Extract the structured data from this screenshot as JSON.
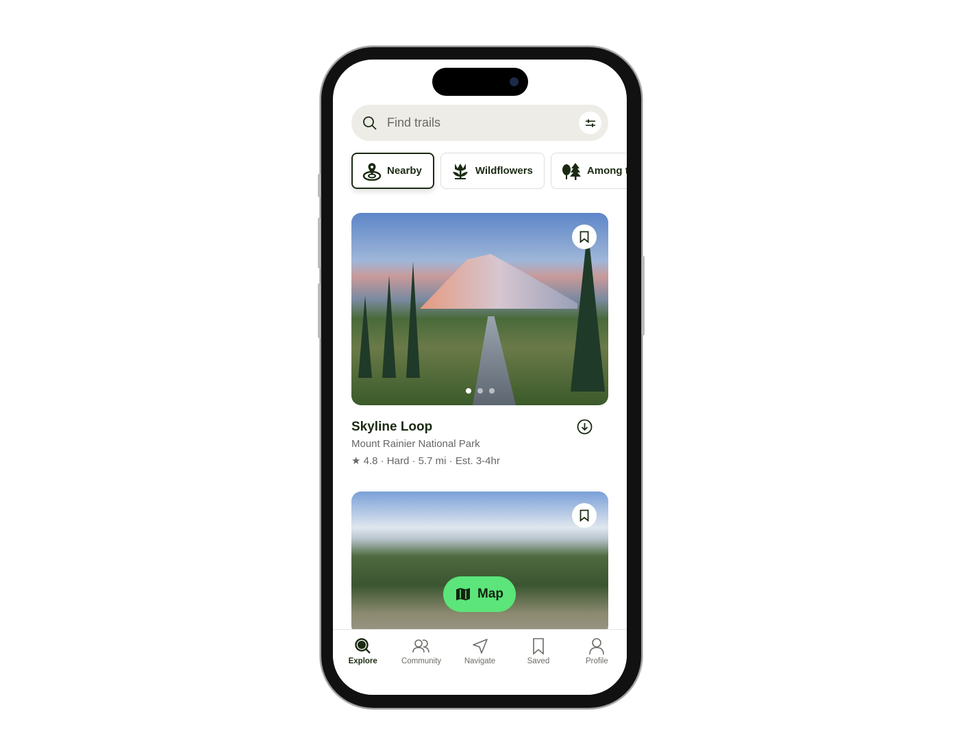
{
  "search": {
    "placeholder": "Find trails",
    "icon": "search-icon",
    "filter_icon": "sliders-icon"
  },
  "chips": [
    {
      "label": "Nearby",
      "icon": "location-pin-icon",
      "active": true
    },
    {
      "label": "Wildflowers",
      "icon": "flower-icon"
    },
    {
      "label": "Among the trees",
      "visible_label": "Among t",
      "icon": "trees-icon"
    }
  ],
  "trails": [
    {
      "name": "Skyline Loop",
      "park": "Mount Rainier National Park",
      "rating": "4.8",
      "difficulty": "Hard",
      "distance": "5.7 mi",
      "time": "Est. 3-4hr",
      "meta": "4.8 · Hard · 5.7 mi · Est. 3-4hr",
      "photos": 3,
      "current_photo": 1
    }
  ],
  "map_button": "Map",
  "nav": [
    {
      "label": "Explore",
      "icon": "explore-icon",
      "active": true
    },
    {
      "label": "Community",
      "icon": "community-icon"
    },
    {
      "label": "Navigate",
      "icon": "navigate-icon"
    },
    {
      "label": "Saved",
      "icon": "bookmark-icon"
    },
    {
      "label": "Profile",
      "icon": "profile-icon"
    }
  ],
  "colors": {
    "accent": "#1b2a12",
    "map_button": "#5be57a",
    "search_bg": "#edece7"
  }
}
